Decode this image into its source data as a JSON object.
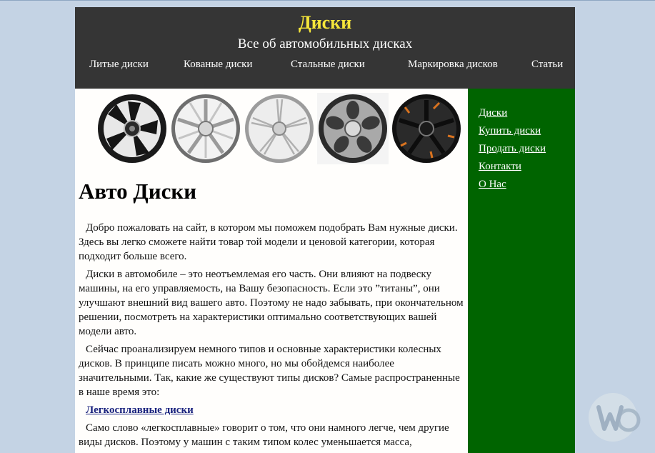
{
  "header": {
    "title": "Диски",
    "subtitle": "Все об автомобильных дисках",
    "nav": [
      "Литые диски",
      "Кованые диски",
      "Стальные диски",
      "Маркировка дисков",
      "Статьи"
    ]
  },
  "sidebar": {
    "links": [
      "Диски",
      "Купить диски",
      "Продать диски",
      "Контакти",
      "О Нас"
    ]
  },
  "main": {
    "heading": "Авто Диски",
    "paragraphs": [
      "Добро пожаловать на сайт, в котором мы поможем подобрать Вам нужные диски. Здесь вы легко сможете найти товар той модели и ценовой категории, которая подходит больше всего.",
      "Диски в автомобиле – это неотъемлемая его часть. Они влияют на подвеску машины, на его управляемость, на Вашу безопасность. Если это ”титаны”, они улучшают внешний вид вашего авто. Поэтому не надо забывать, при окончательном решении, посмотреть на характеристики оптимально соответствующих вашей модели авто.",
      "Сейчас проанализируем немного типов и основные характеристики колесных дисков. В принципе  писать можно много, но мы обойдемся наиболее значительными. Так, какие же существуют типы дисков? Самые распространенные в наше время это:"
    ],
    "section_link": "Легкосплавные диски",
    "last_paragraph": "Само слово «легкосплавные» говорит о том, что они намного легче, чем другие виды дисков. Поэтому у машин с таким типом колес уменьшается масса,"
  },
  "colors": {
    "background": "#c4d3e4",
    "header_bg": "#353535",
    "title_yellow": "#f5e63a",
    "sidebar_green": "#006400",
    "section_link": "#1a237e"
  },
  "icons": [
    "wheel-image-1",
    "wheel-image-2",
    "wheel-image-3",
    "wheel-image-4",
    "wheel-image-5",
    "watermark-logo-icon"
  ]
}
